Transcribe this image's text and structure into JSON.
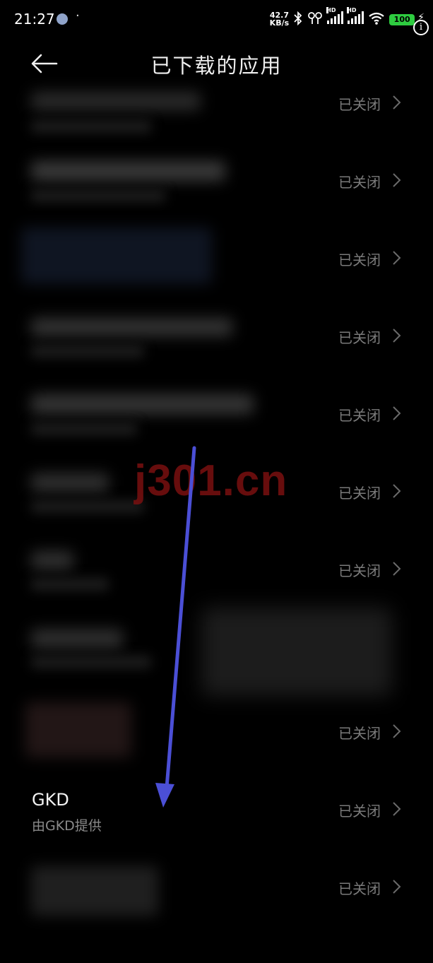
{
  "status_bar": {
    "time": "21:27",
    "dot": "·",
    "speed_value": "42.7",
    "speed_unit": "KB/s",
    "battery": "100",
    "hd_label": "HD"
  },
  "header": {
    "title": "已下载的应用"
  },
  "apps": [
    {
      "status": "已关闭"
    },
    {
      "status": "已关闭"
    },
    {
      "status": "已关闭"
    },
    {
      "status": "已关闭"
    },
    {
      "status": "已关闭"
    },
    {
      "status": "已关闭"
    },
    {
      "status": "已关闭"
    },
    {
      "status": ""
    },
    {
      "status": "已关闭"
    },
    {
      "name": "GKD",
      "subtitle": "由GKD提供",
      "status": "已关闭"
    },
    {
      "status": "已关闭"
    }
  ],
  "watermark": "j301.cn",
  "colors": {
    "background": "#000000",
    "status_text": "#7a7a7a",
    "arrow": "#4b4fd6",
    "watermark": "#7a1010",
    "battery": "#2ecc40"
  }
}
